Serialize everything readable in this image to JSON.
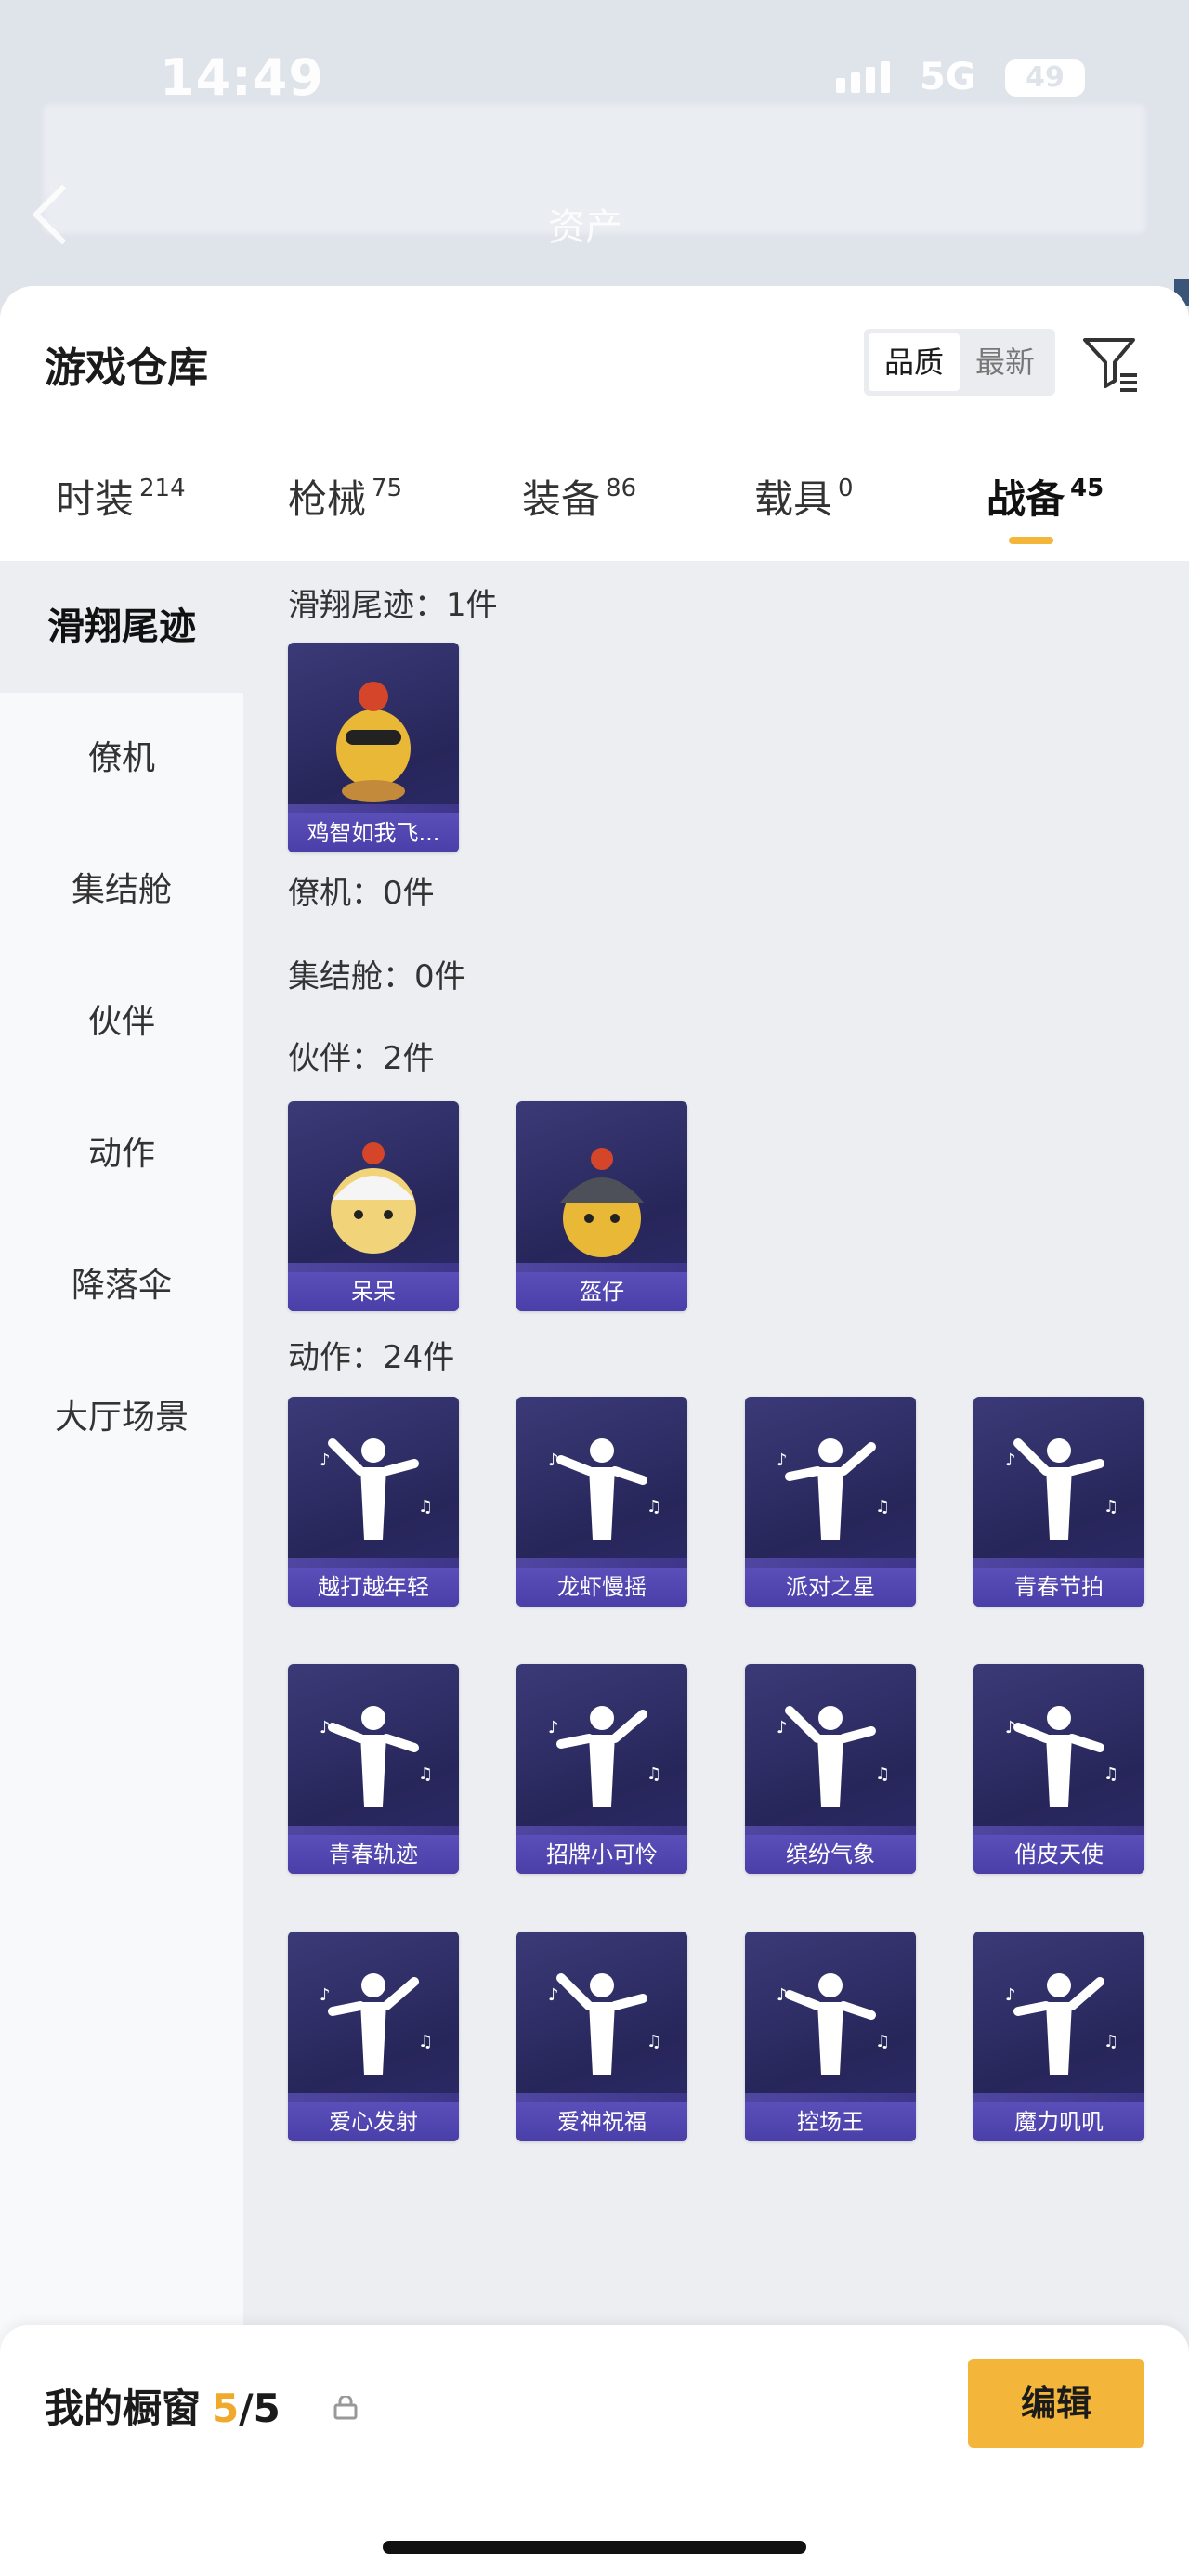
{
  "status_bar": {
    "time": "14:49",
    "network": "5G",
    "battery": "49"
  },
  "header": {
    "blurred_title": "资产"
  },
  "sheet": {
    "title": "游戏仓库",
    "sort": {
      "options": [
        "品质",
        "最新"
      ],
      "active": "品质"
    }
  },
  "tabs": [
    {
      "label": "时装",
      "count": "214"
    },
    {
      "label": "枪械",
      "count": "75"
    },
    {
      "label": "装备",
      "count": "86"
    },
    {
      "label": "载具",
      "count": "0"
    },
    {
      "label": "战备",
      "count": "45"
    }
  ],
  "sidebar": {
    "items": [
      "滑翔尾迹",
      "僚机",
      "集结舱",
      "伙伴",
      "动作",
      "降落伞",
      "大厅场景"
    ]
  },
  "sections": {
    "glide": {
      "title": "滑翔尾迹：1件",
      "items": [
        "鸡智如我飞..."
      ]
    },
    "wingman": {
      "title": "僚机：0件"
    },
    "pod": {
      "title": "集结舱：0件"
    },
    "partner": {
      "title": "伙伴：2件",
      "items": [
        "呆呆",
        "盔仔"
      ]
    },
    "action": {
      "title": "动作：24件",
      "items": [
        "越打越年轻",
        "龙虾慢摇",
        "派对之星",
        "青春节拍",
        "青春轨迹",
        "招牌小可怜",
        "缤纷气象",
        "俏皮天使",
        "爱心发射",
        "爱神祝福",
        "控场王",
        "魔力叽叽"
      ]
    }
  },
  "bottom": {
    "title": "我的橱窗",
    "count_current": "5",
    "count_total": "/5",
    "edit_label": "编辑"
  },
  "colors": {
    "accent": "#f3b63a",
    "card_purple": "#2e2a6a",
    "label_purple": "#4a3fa8"
  }
}
